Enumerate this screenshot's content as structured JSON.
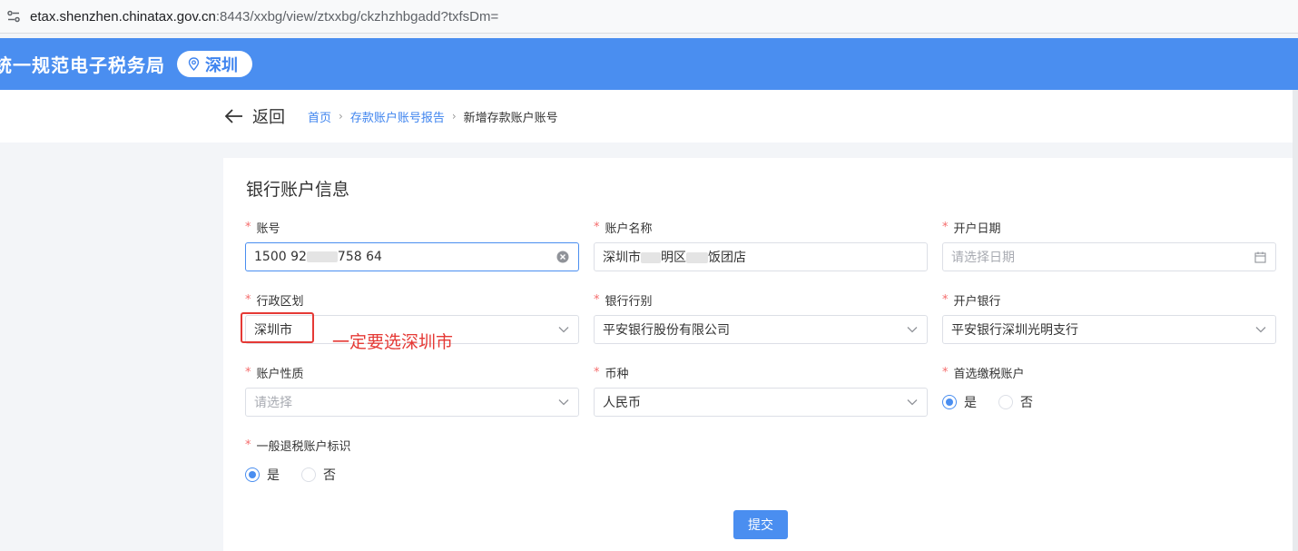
{
  "browser": {
    "url_host": "etax.shenzhen.chinatax.gov.cn",
    "url_rest": ":8443/xxbg/view/ztxxbg/ckzhzhbgadd?txfsDm="
  },
  "header": {
    "title": "统一规范电子税务局",
    "city": "深圳",
    "color": "#4a8ef0"
  },
  "nav": {
    "back_label": "返回",
    "breadcrumb": [
      "首页",
      "存款账户账号报告",
      "新增存款账户账号"
    ]
  },
  "form": {
    "title": "银行账户信息",
    "fields": {
      "account_no": {
        "label": "账号",
        "value_a": "1500 92",
        "value_b": "758 64"
      },
      "account_name": {
        "label": "账户名称",
        "value_a": "深圳市",
        "value_b": "明区",
        "value_c": "饭团店"
      },
      "open_date": {
        "label": "开户日期",
        "placeholder": "请选择日期"
      },
      "region": {
        "label": "行政区划",
        "value": "深圳市"
      },
      "bank_type": {
        "label": "银行行别",
        "value": "平安银行股份有限公司"
      },
      "open_bank": {
        "label": "开户银行",
        "value": "平安银行深圳光明支行"
      },
      "account_nature": {
        "label": "账户性质",
        "placeholder": "请选择"
      },
      "currency": {
        "label": "币种",
        "value": "人民币"
      },
      "preferred_tax": {
        "label": "首选缴税账户",
        "options": [
          "是",
          "否"
        ],
        "selected": "是"
      },
      "refund_flag": {
        "label": "一般退税账户标识",
        "options": [
          "是",
          "否"
        ],
        "selected": "是"
      }
    },
    "required_mark": "*",
    "submit_label": "提交"
  },
  "annotation": {
    "text": "一定要选深圳市",
    "color": "#e53935"
  }
}
